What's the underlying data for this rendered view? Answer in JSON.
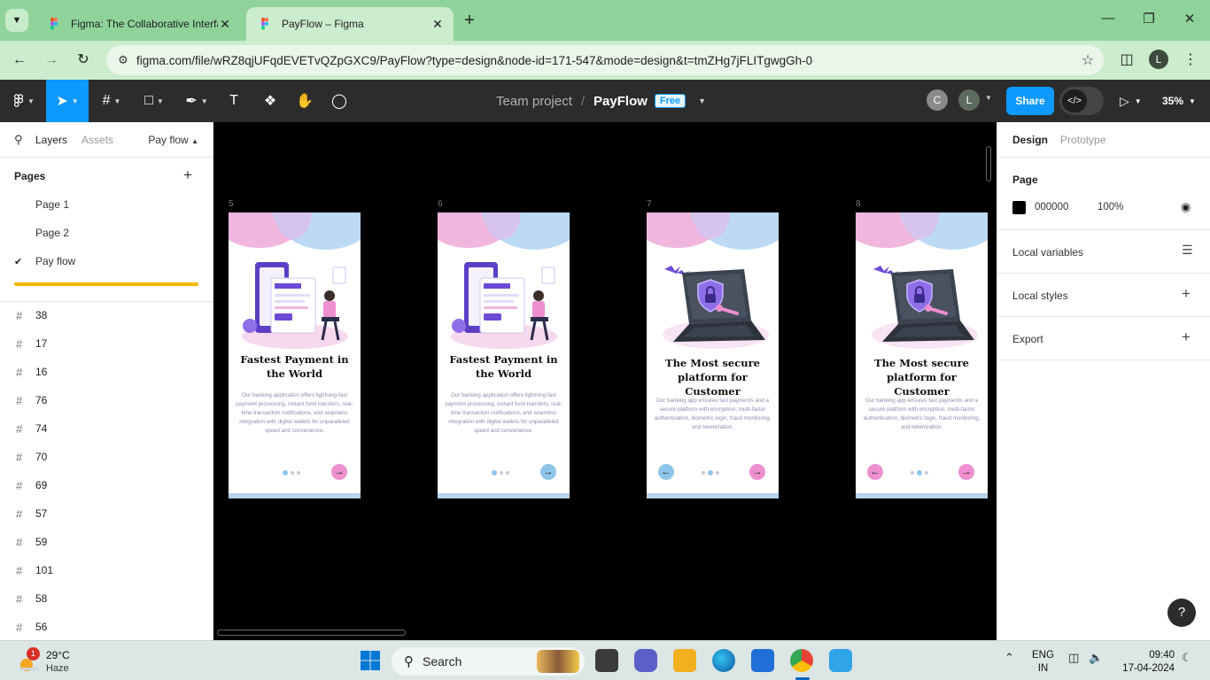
{
  "browser": {
    "tabs": [
      {
        "title": "Figma: The Collaborative Interface Design Tool",
        "active": false
      },
      {
        "title": "PayFlow – Figma",
        "active": true
      }
    ],
    "url": "figma.com/file/wRZ8qjUFqdEVETvQZpGXC9/PayFlow?type=design&node-id=171-547&mode=design&t=tmZHg7jFLITgwgGh-0",
    "profile_initial": "L"
  },
  "figma": {
    "team": "Team project",
    "slash": "/",
    "file_name": "PayFlow",
    "plan_badge": "Free",
    "collaborators": [
      {
        "initial": "C",
        "color": "#8a8a8a"
      },
      {
        "initial": "L",
        "color": "#5e6b5f"
      }
    ],
    "share_label": "Share",
    "zoom": "35%",
    "dev_mode_icon": "</>"
  },
  "left_panel": {
    "tabs": {
      "layers": "Layers",
      "assets": "Assets"
    },
    "current_page": "Pay flow",
    "pages_title": "Pages",
    "pages": [
      "Page 1",
      "Page 2",
      "Pay flow"
    ],
    "selected_page": "Pay flow",
    "layers": [
      "38",
      "17",
      "16",
      "76",
      "74",
      "70",
      "69",
      "57",
      "59",
      "101",
      "58",
      "56"
    ]
  },
  "canvas": {
    "frames": [
      {
        "label": "5",
        "title": "Fastest Payment in the World",
        "body": "Our banking application offers lightning-fast payment processing, instant fund transfers, real-time transaction notifications, and seamless integration with digital wallets for unparalleled speed and convenience.",
        "illustration": "payment-illustration",
        "has_back": false,
        "active_dot": 0
      },
      {
        "label": "6",
        "title": "Fastest Payment in the World",
        "body": "Our banking application offers lightning-fast payment processing, instant fund transfers, real-time transaction notifications, and seamless integration with digital wallets for unparalleled speed and convenience.",
        "illustration": "payment-illustration",
        "has_back": false,
        "active_dot": 0
      },
      {
        "label": "7",
        "title": "The Most secure platform for Customer",
        "body": "Our banking app ensures fast payments and a secure platform with encryption, multi-factor authentication, biometric login, fraud monitoring, and tokenization.",
        "illustration": "security-laptop-illustration",
        "has_back": true,
        "active_dot": 1
      },
      {
        "label": "8",
        "title": "The Most secure platform for Customer",
        "body": "Our banking app ensures fast payments and a secure platform with encryption, multi-factor authentication, biometric login, fraud monitoring, and tokenization.",
        "illustration": "security-laptop-illustration",
        "has_back": true,
        "active_dot": 1
      }
    ],
    "colors": {
      "pink": "#f1b6dd",
      "blue": "#bcdaf4",
      "purple": "#6b4bd6",
      "next_circle": "#ee8fd0",
      "first_next_circle": "#8fc4ea"
    }
  },
  "right_panel": {
    "tabs": {
      "design": "Design",
      "prototype": "Prototype"
    },
    "page_section": "Page",
    "page_color": "000000",
    "page_opacity": "100%",
    "local_variables": "Local variables",
    "local_styles": "Local styles",
    "export": "Export"
  },
  "help_label": "?",
  "taskbar": {
    "weather_temp": "29°C",
    "weather_cond": "Haze",
    "weather_badge": "1",
    "search_label": "Search",
    "lang_line1": "ENG",
    "lang_line2": "IN",
    "time": "09:40",
    "date": "17-04-2024"
  }
}
